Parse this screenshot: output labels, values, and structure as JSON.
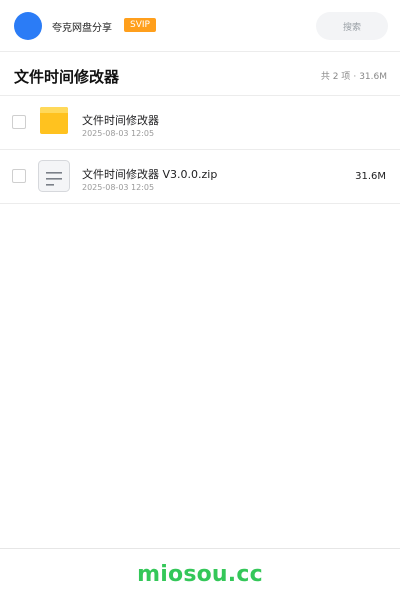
{
  "header": {
    "username": "夸克网盘分享",
    "vip_badge": "SVIP",
    "search_placeholder": "搜索"
  },
  "folder": {
    "title": "文件时间修改器",
    "summary_count": "共 2 项",
    "summary_separator": "·",
    "summary_size": "31.6M"
  },
  "files": [
    {
      "name": "文件时间修改器",
      "date": "2025-08-03 12:05",
      "size": "",
      "icon": "folder-icon"
    },
    {
      "name": "文件时间修改器 V3.0.0.zip",
      "date": "2025-08-03 12:05",
      "size": "31.6M",
      "icon": "archive-file-icon"
    }
  ],
  "footer": {
    "brand": "miosou.cc"
  },
  "colors": {
    "avatar": "#2b7cf6",
    "vip_badge": "#ff9f1c",
    "folder": "#ffc21f",
    "brand": "#34c759"
  }
}
